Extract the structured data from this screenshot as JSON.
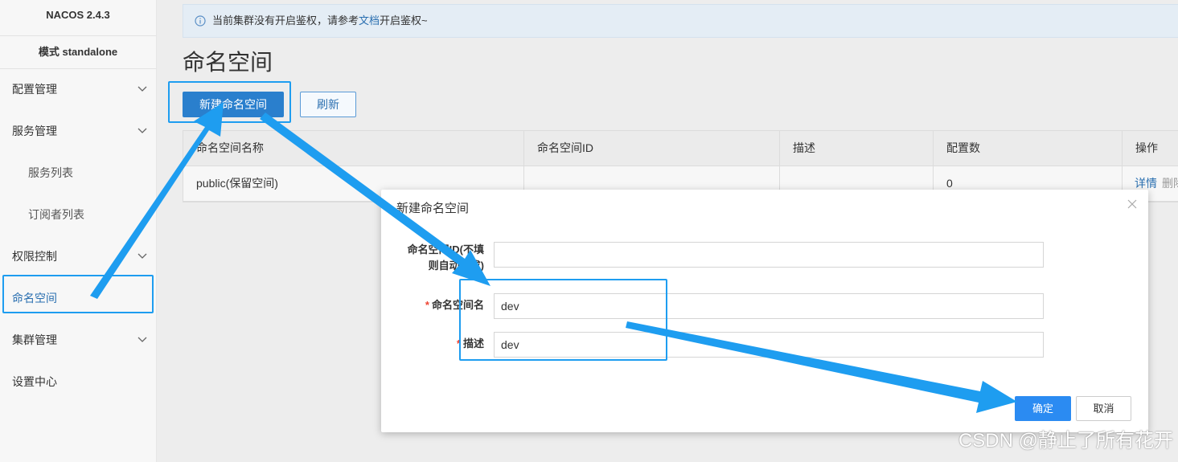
{
  "brand": "NACOS 2.4.3",
  "mode": "模式 standalone",
  "nav": [
    {
      "label": "配置管理",
      "chevron": true
    },
    {
      "label": "服务管理",
      "chevron": true
    },
    {
      "label": "服务列表",
      "sub": true
    },
    {
      "label": "订阅者列表",
      "sub": true
    },
    {
      "label": "权限控制",
      "chevron": true
    },
    {
      "label": "命名空间",
      "active": true
    },
    {
      "label": "集群管理",
      "chevron": true
    },
    {
      "label": "设置中心"
    }
  ],
  "notice": {
    "prefix": "当前集群没有开启鉴权，请参考",
    "link": "文档",
    "suffix": "开启鉴权~"
  },
  "page_title": "命名空间",
  "buttons": {
    "create": "新建命名空间",
    "refresh": "刷新"
  },
  "table": {
    "headers": [
      "命名空间名称",
      "命名空间ID",
      "描述",
      "配置数",
      "操作"
    ],
    "rows": [
      {
        "name": "public(保留空间)",
        "id": "",
        "desc": "",
        "count": "0",
        "action_detail": "详情",
        "action_delete": "删除"
      }
    ]
  },
  "modal": {
    "title": "新建命名空间",
    "id_label_line1": "命名空间ID(不填",
    "id_label_line2": "则自动生成)",
    "name_label": "命名空间名",
    "desc_label": "描述",
    "id_value": "",
    "name_value": "dev",
    "desc_value": "dev",
    "ok": "确定",
    "cancel": "取消"
  },
  "watermark": "CSDN @静止了所有花开",
  "colors": {
    "accent": "#2a7fcd",
    "annotation": "#1e9df0",
    "link": "#2a6fb0"
  }
}
